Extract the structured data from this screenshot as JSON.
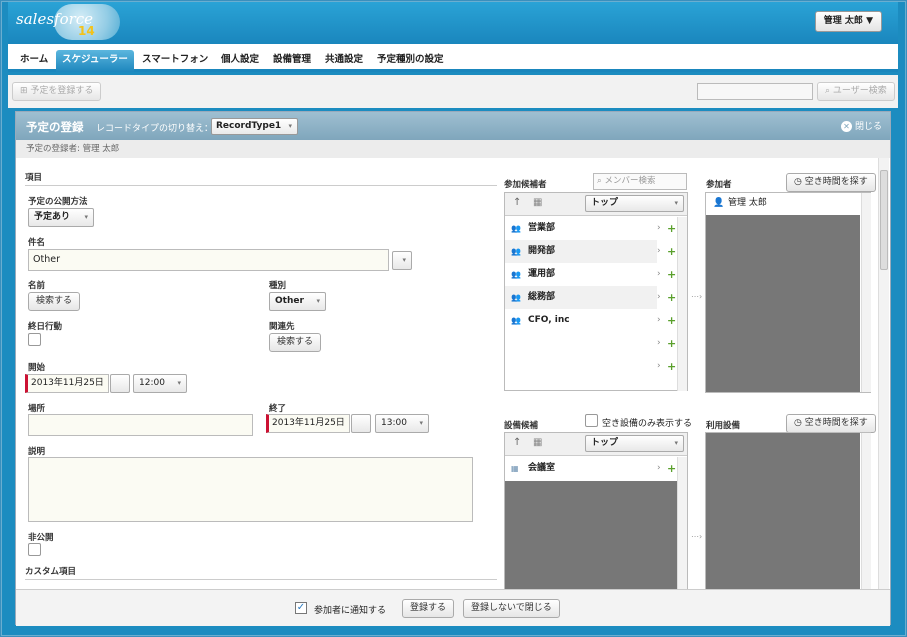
{
  "header": {
    "logo_word": "salesforce",
    "logo_version": "14",
    "user_menu": "管理 太郎 ▼"
  },
  "tabs": [
    "ホーム",
    "スケジューラー",
    "スマートフォン",
    "個人設定",
    "設備管理",
    "共通設定",
    "予定種別の設定"
  ],
  "toolbar": {
    "register_label": "予定を登録する",
    "search_placeholder": "",
    "user_search": "ユーザー検索"
  },
  "dialog": {
    "title": "予定の登録",
    "record_type_label": "レコードタイプの切り替え：",
    "record_type_value": "RecordType1",
    "close_label": "閉じる",
    "registrant": "予定の登録者: 管理 太郎",
    "section_items": "項目",
    "publish_label": "予定の公開方法",
    "publish_value": "予定あり",
    "subject_label": "件名",
    "subject_value": "Other",
    "name_label": "名前",
    "search_button": "検索する",
    "type_label": "種別",
    "type_value": "Other",
    "allday_label": "終日行動",
    "related_label": "関連先",
    "start_label": "開始",
    "start_date": "2013年11月25日",
    "start_time": "12:00",
    "place_label": "場所",
    "end_label": "終了",
    "end_date": "2013年11月25日",
    "end_time": "13:00",
    "desc_label": "説明",
    "private_label": "非公開",
    "custom_label": "カスタム項目"
  },
  "candidates": {
    "title": "参加候補者",
    "member_search_placeholder": "メンバー検索",
    "top_label": "トップ",
    "groups": [
      "営業部",
      "開発部",
      "運用部",
      "総務部",
      "CFO, inc"
    ]
  },
  "participants": {
    "title": "参加者",
    "find_free": "空き時間を探す",
    "items": [
      "管理 太郎"
    ]
  },
  "equipment": {
    "title": "設備候補",
    "only_free": "空き設備のみ表示する",
    "top_label": "トップ",
    "items": [
      "会議室"
    ]
  },
  "used_equipment": {
    "title": "利用設備",
    "find_free": "空き時間を探す"
  },
  "footer": {
    "notify_label": "参加者に通知する",
    "register": "登録する",
    "close_without": "登録しないで閉じる"
  }
}
